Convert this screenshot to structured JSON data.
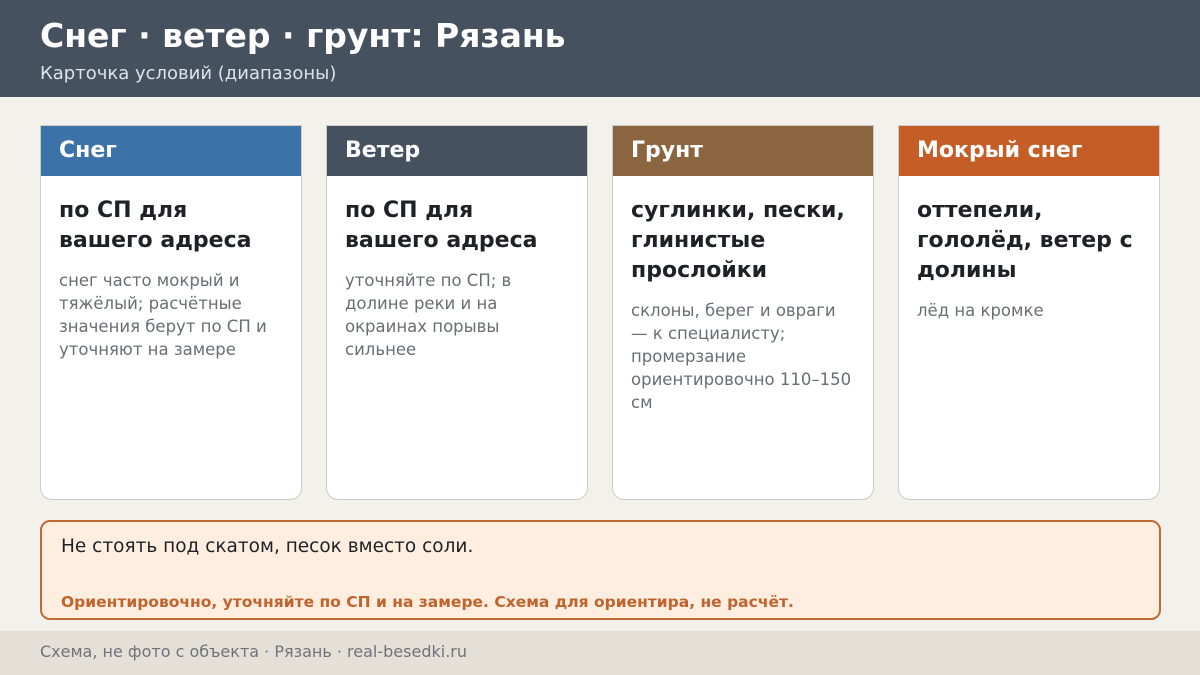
{
  "header": {
    "title": "Снег · ветер · грунт: Рязань",
    "subtitle": "Карточка условий (диапазоны)"
  },
  "cards": [
    {
      "heading": "Снег",
      "main": "по СП для вашего адреса",
      "note": "снег часто мокрый и тяжёлый; расчётные значения берут по СП и уточняют на замере",
      "color": "#3b72a8"
    },
    {
      "heading": "Ветер",
      "main": "по СП для вашего адреса",
      "note": "уточняйте по СП; в долине реки и на окраинах порывы сильнее",
      "color": "#465160"
    },
    {
      "heading": "Грунт",
      "main": "суглинки, пески, глинистые прослойки",
      "note": "склоны, берег и овраги — к специалисту; промерзание ориентировочно 110–150 см",
      "color": "#8b6440"
    },
    {
      "heading": "Мокрый снег",
      "main": "оттепели, гололёд, ветер с долины",
      "note": "лёд на кромке",
      "color": "#c55d27"
    }
  ],
  "notice": {
    "text": "Не стоять под скатом, песок вместо соли.",
    "warning": "Ориентировочно, уточняйте по СП и на замере. Схема для ориентира, не расчёт."
  },
  "footer": {
    "text": "Схема, не фото с объекта  ·  Рязань  ·  real-besedki.ru"
  }
}
